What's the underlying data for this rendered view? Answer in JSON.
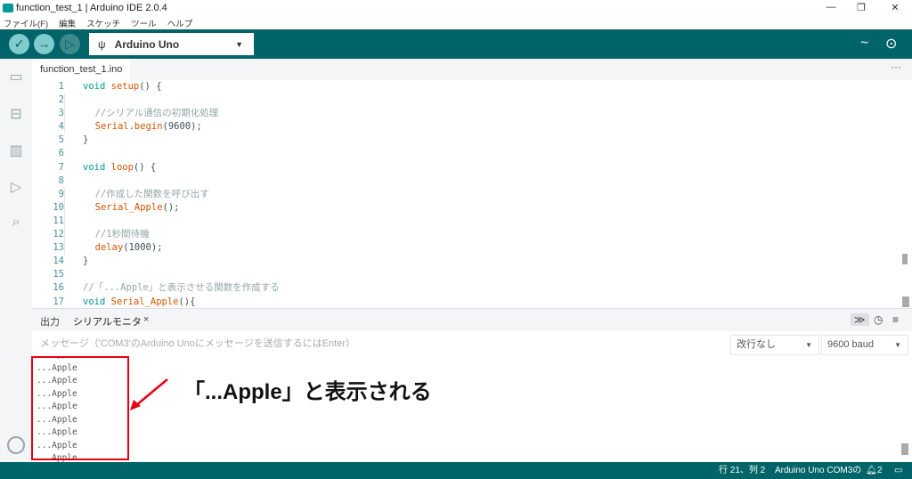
{
  "window": {
    "title": "function_test_1 | Arduino IDE 2.0.4",
    "minimize": "—",
    "maximize": "❐",
    "close": "✕"
  },
  "menu": [
    "ファイル(F)",
    "編集",
    "スケッチ",
    "ツール",
    "ヘルプ"
  ],
  "toolbar": {
    "verify_icon": "check-icon",
    "upload_icon": "arrow-right-icon",
    "debug_icon": "debug-icon",
    "board": "Arduino Uno",
    "plotter_icon": "~",
    "monitor_icon": "⊙"
  },
  "tab": {
    "name": "function_test_1.ino",
    "more": "···"
  },
  "code": [
    [
      [
        "void",
        "kw"
      ],
      " ",
      [
        "setup",
        "fn"
      ],
      "() {"
    ],
    [],
    [
      "  ",
      [
        "//シリアル通信の初期化処理",
        "cm"
      ]
    ],
    [
      "  ",
      [
        "Serial",
        "fn"
      ],
      ".",
      [
        "begin",
        "fn"
      ],
      "(9600);"
    ],
    [
      "}"
    ],
    [],
    [
      [
        "void",
        "kw"
      ],
      " ",
      [
        "loop",
        "fn"
      ],
      "() {"
    ],
    [],
    [
      "  ",
      [
        "//作成した関数を呼び出す",
        "cm"
      ]
    ],
    [
      "  ",
      [
        "Serial_Apple",
        "fn"
      ],
      "();"
    ],
    [],
    [
      "  ",
      [
        "//1秒間待機",
        "cm"
      ]
    ],
    [
      "  ",
      [
        "delay",
        "fn"
      ],
      "(1000);"
    ],
    [
      "}"
    ],
    [],
    [
      [
        "//「...Apple」と表示させる関数を作成する",
        "cm"
      ]
    ],
    [
      [
        "void",
        "kw"
      ],
      " ",
      [
        "Serial_Apple",
        "fn"
      ],
      "(){"
    ]
  ],
  "panel": {
    "tab_output": "出力",
    "tab_serial": "シリアルモニタ",
    "close": "×",
    "message_placeholder": "メッセージ（'COM3'のArduino Unoにメッセージを送信するにはEnter）",
    "line_ending": "改行なし",
    "baud": "9600 baud"
  },
  "serial_output": [
    "...Apple",
    "...Apple",
    "...Apple",
    "...Apple",
    "...Apple",
    "...Apple",
    "...Apple",
    "...Apple"
  ],
  "annotation": "「...Apple」と表示される",
  "status": {
    "position": "行 21、列 2",
    "board": "Arduino Uno COM3の",
    "notifications": "2"
  },
  "colors": {
    "teal": "#006468",
    "highlight": "#e60012"
  }
}
